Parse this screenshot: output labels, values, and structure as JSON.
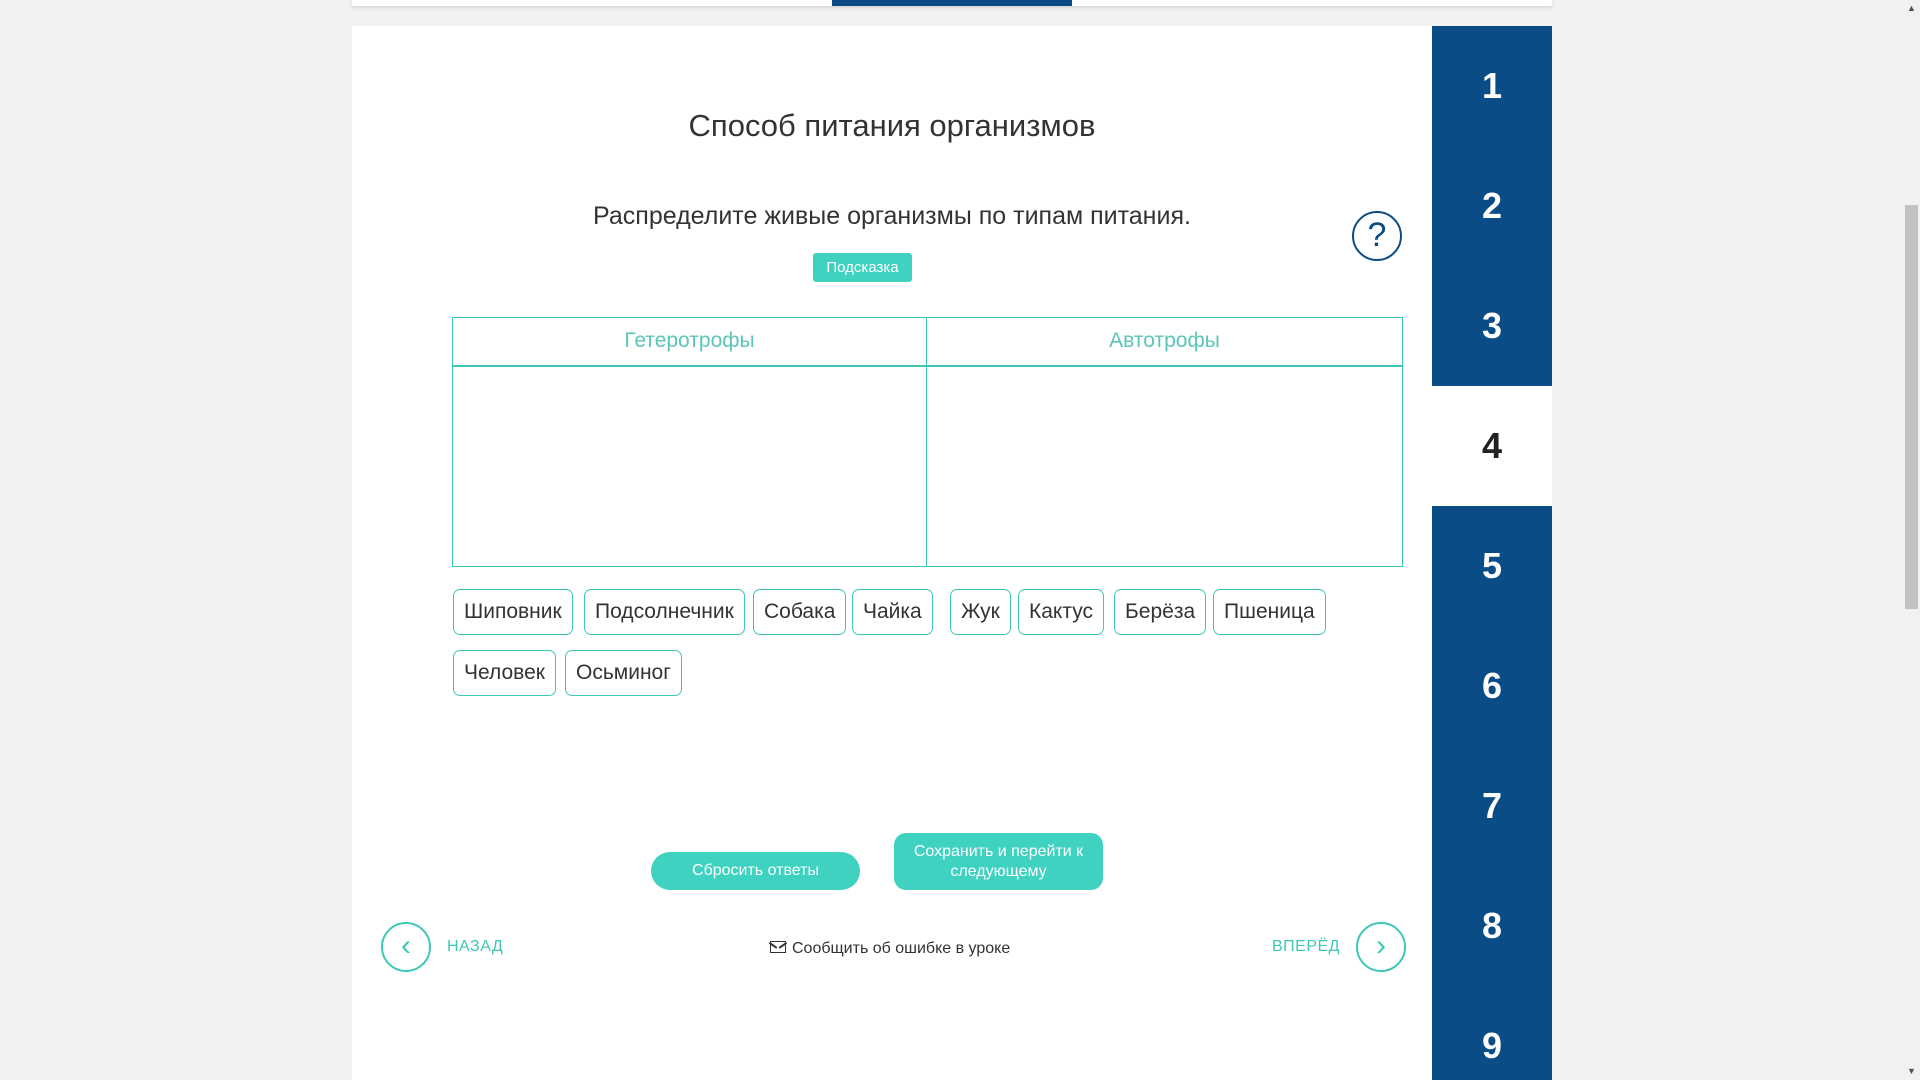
{
  "lesson": {
    "title": "Способ питания организмов",
    "instruction": "Распределите живые организмы по типам питания.",
    "hint_label": "Подсказка",
    "help_glyph": "?"
  },
  "table": {
    "columns": [
      "Гетеротрофы",
      "Автотрофы"
    ]
  },
  "chips": [
    "Шиповник",
    "Подсолнечник",
    "Собака",
    "Чайка",
    "Жук",
    "Кактус",
    "Берёза",
    "Пшеница",
    "Человек",
    "Осьминог"
  ],
  "actions": {
    "reset_label": "Сбросить ответы",
    "save_label": "Сохранить и перейти к следующему"
  },
  "nav": {
    "back_label": "НАЗАД",
    "forward_label": "ВПЕРЁД",
    "report_label": "Сообщить об ошибке в уроке"
  },
  "steps": {
    "items": [
      "1",
      "2",
      "3",
      "4",
      "5",
      "6",
      "7",
      "8",
      "9"
    ],
    "active": "4"
  },
  "colors": {
    "accent": "#3fd2c0",
    "border_accent": "#3fc7b5",
    "sidebar": "#0a4d86"
  }
}
